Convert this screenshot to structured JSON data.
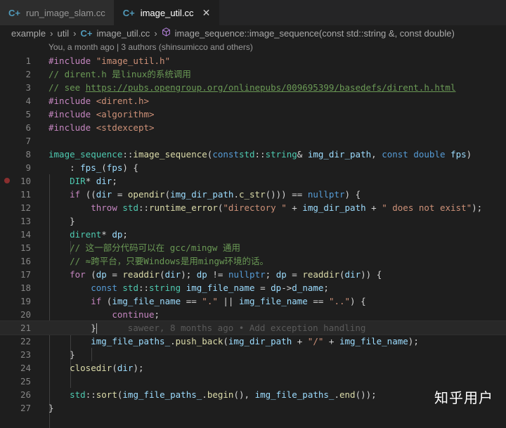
{
  "tabs": [
    {
      "label": "run_image_slam.cc",
      "icon": "cpp-file-icon"
    },
    {
      "label": "image_util.cc",
      "icon": "cpp-file-icon",
      "close": "✕"
    }
  ],
  "file_icon_glyph": "C+",
  "breadcrumb": {
    "folder1": "example",
    "folder2": "util",
    "file": "image_util.cc",
    "symbol": "image_sequence::image_sequence(const std::string &, const double)"
  },
  "codelens": "You, a month ago | 3 authors (shinsumicco and others)",
  "blame": "saweer, 8 months ago • Add exception handling",
  "watermark": "知乎用户",
  "colors": {
    "keyword": "#569cd6",
    "control": "#c586c0",
    "string": "#ce9178",
    "comment": "#6a9955",
    "type": "#4ec9b0",
    "function": "#dcdcaa",
    "variable": "#9cdcfe"
  },
  "lines": [
    {
      "n": "1",
      "t": [
        [
          "pp",
          "#include "
        ],
        [
          "str",
          "\"image_util.h\""
        ]
      ]
    },
    {
      "n": "2",
      "t": [
        [
          "cm",
          "// dirent.h 是linux的系统调用"
        ]
      ]
    },
    {
      "n": "3",
      "t": [
        [
          "cm",
          "// see "
        ],
        [
          "url",
          "https://pubs.opengroup.org/onlinepubs/009695399/basedefs/dirent.h.html"
        ]
      ]
    },
    {
      "n": "4",
      "t": [
        [
          "pp",
          "#include "
        ],
        [
          "str",
          "<dirent.h>"
        ]
      ]
    },
    {
      "n": "5",
      "t": [
        [
          "pp",
          "#include "
        ],
        [
          "str",
          "<algorithm>"
        ]
      ]
    },
    {
      "n": "6",
      "t": [
        [
          "pp",
          "#include "
        ],
        [
          "str",
          "<stdexcept>"
        ]
      ]
    },
    {
      "n": "7",
      "t": []
    },
    {
      "n": "8",
      "t": [
        [
          "ty",
          "image_sequence"
        ],
        [
          "",
          "::"
        ],
        [
          "fn",
          "image_sequence"
        ],
        [
          "",
          "("
        ],
        [
          "kw",
          "const"
        ],
        [
          "",
          "",
          " "
        ],
        [
          "ty",
          "std"
        ],
        [
          "",
          "::"
        ],
        [
          "ty",
          "string"
        ],
        [
          "",
          "& "
        ],
        [
          "var",
          "img_dir_path"
        ],
        [
          "",
          ", "
        ],
        [
          "kw",
          "const"
        ],
        [
          "kw",
          " double"
        ],
        [
          "",
          " "
        ],
        [
          "var",
          "fps"
        ],
        [
          "",
          ")"
        ]
      ]
    },
    {
      "n": "9",
      "t": [
        [
          "",
          "    : "
        ],
        [
          "var",
          "fps_"
        ],
        [
          "",
          "("
        ],
        [
          "var",
          "fps"
        ],
        [
          "",
          ") {"
        ]
      ]
    },
    {
      "n": "10",
      "bp": true,
      "t": [
        [
          "",
          "    "
        ],
        [
          "ty",
          "DIR"
        ],
        [
          "",
          "* "
        ],
        [
          "var",
          "dir"
        ],
        [
          "",
          ";"
        ]
      ]
    },
    {
      "n": "11",
      "t": [
        [
          "",
          "    "
        ],
        [
          "ctl",
          "if"
        ],
        [
          "",
          " (("
        ],
        [
          "var",
          "dir"
        ],
        [
          "",
          " = "
        ],
        [
          "fn",
          "opendir"
        ],
        [
          "",
          "("
        ],
        [
          "var",
          "img_dir_path"
        ],
        [
          "",
          "."
        ],
        [
          "fn",
          "c_str"
        ],
        [
          "",
          "())) == "
        ],
        [
          "kw",
          "nullptr"
        ],
        [
          "",
          ") {"
        ]
      ]
    },
    {
      "n": "12",
      "t": [
        [
          "",
          "        "
        ],
        [
          "ctl",
          "throw"
        ],
        [
          "",
          " "
        ],
        [
          "ty",
          "std"
        ],
        [
          "",
          "::"
        ],
        [
          "fn",
          "runtime_error"
        ],
        [
          "",
          "("
        ],
        [
          "str",
          "\"directory \""
        ],
        [
          "",
          " + "
        ],
        [
          "var",
          "img_dir_path"
        ],
        [
          "",
          " + "
        ],
        [
          "str",
          "\" does not exist\""
        ],
        [
          "",
          ");"
        ]
      ]
    },
    {
      "n": "13",
      "t": [
        [
          "",
          "    }"
        ]
      ]
    },
    {
      "n": "14",
      "t": [
        [
          "",
          "    "
        ],
        [
          "ty",
          "dirent"
        ],
        [
          "",
          "* "
        ],
        [
          "var",
          "dp"
        ],
        [
          "",
          ";"
        ]
      ]
    },
    {
      "n": "15",
      "t": [
        [
          "",
          "    "
        ],
        [
          "cm",
          "// 这一部分代码可以在 gcc/mingw 通用"
        ]
      ]
    },
    {
      "n": "16",
      "t": [
        [
          "",
          "    "
        ],
        [
          "cm",
          "// ≈跨平台，只要Windows是用mingw环境的话。"
        ]
      ]
    },
    {
      "n": "17",
      "t": [
        [
          "",
          "    "
        ],
        [
          "ctl",
          "for"
        ],
        [
          "",
          " ("
        ],
        [
          "var",
          "dp"
        ],
        [
          "",
          " = "
        ],
        [
          "fn",
          "readdir"
        ],
        [
          "",
          "("
        ],
        [
          "var",
          "dir"
        ],
        [
          "",
          "); "
        ],
        [
          "var",
          "dp"
        ],
        [
          "",
          " != "
        ],
        [
          "kw",
          "nullptr"
        ],
        [
          "",
          "; "
        ],
        [
          "var",
          "dp"
        ],
        [
          "",
          " = "
        ],
        [
          "fn",
          "readdir"
        ],
        [
          "",
          "("
        ],
        [
          "var",
          "dir"
        ],
        [
          "",
          ")) {"
        ]
      ]
    },
    {
      "n": "18",
      "t": [
        [
          "",
          "        "
        ],
        [
          "kw",
          "const"
        ],
        [
          "",
          " "
        ],
        [
          "ty",
          "std"
        ],
        [
          "",
          "::"
        ],
        [
          "ty",
          "string"
        ],
        [
          "",
          " "
        ],
        [
          "var",
          "img_file_name"
        ],
        [
          "",
          " = "
        ],
        [
          "var",
          "dp"
        ],
        [
          "",
          "->"
        ],
        [
          "var",
          "d_name"
        ],
        [
          "",
          ";"
        ]
      ]
    },
    {
      "n": "19",
      "t": [
        [
          "",
          "        "
        ],
        [
          "ctl",
          "if"
        ],
        [
          "",
          " ("
        ],
        [
          "var",
          "img_file_name"
        ],
        [
          "",
          " == "
        ],
        [
          "str",
          "\".\""
        ],
        [
          "",
          " || "
        ],
        [
          "var",
          "img_file_name"
        ],
        [
          "",
          " == "
        ],
        [
          "str",
          "\"..\""
        ],
        [
          "",
          ") {"
        ]
      ]
    },
    {
      "n": "20",
      "t": [
        [
          "",
          "            "
        ],
        [
          "ctl",
          "continue"
        ],
        [
          "",
          ";"
        ]
      ]
    },
    {
      "n": "21",
      "current": true,
      "t": [
        [
          "",
          "        }"
        ]
      ]
    },
    {
      "n": "22",
      "t": [
        [
          "",
          "        "
        ],
        [
          "var",
          "img_file_paths_"
        ],
        [
          "",
          "."
        ],
        [
          "fn",
          "push_back"
        ],
        [
          "",
          "("
        ],
        [
          "var",
          "img_dir_path"
        ],
        [
          "",
          " + "
        ],
        [
          "str",
          "\"/\""
        ],
        [
          "",
          " + "
        ],
        [
          "var",
          "img_file_name"
        ],
        [
          "",
          ");"
        ]
      ]
    },
    {
      "n": "23",
      "t": [
        [
          "",
          "    }"
        ]
      ]
    },
    {
      "n": "24",
      "t": [
        [
          "",
          "    "
        ],
        [
          "fn",
          "closedir"
        ],
        [
          "",
          "("
        ],
        [
          "var",
          "dir"
        ],
        [
          "",
          ");"
        ]
      ]
    },
    {
      "n": "25",
      "t": []
    },
    {
      "n": "26",
      "t": [
        [
          "",
          "    "
        ],
        [
          "ty",
          "std"
        ],
        [
          "",
          "::"
        ],
        [
          "fn",
          "sort"
        ],
        [
          "",
          "("
        ],
        [
          "var",
          "img_file_paths_"
        ],
        [
          "",
          "."
        ],
        [
          "fn",
          "begin"
        ],
        [
          "",
          "(), "
        ],
        [
          "var",
          "img_file_paths_"
        ],
        [
          "",
          "."
        ],
        [
          "fn",
          "end"
        ],
        [
          "",
          "());"
        ]
      ]
    },
    {
      "n": "27",
      "t": [
        [
          "",
          "}"
        ]
      ]
    }
  ]
}
